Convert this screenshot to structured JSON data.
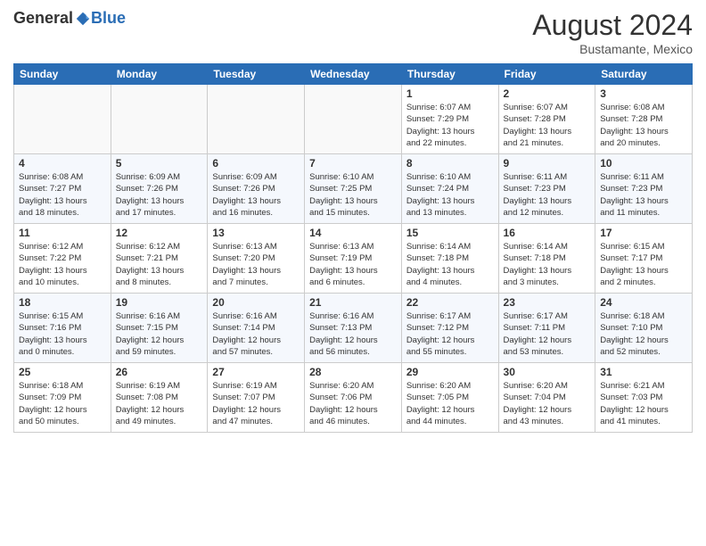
{
  "header": {
    "logo_general": "General",
    "logo_blue": "Blue",
    "month_year": "August 2024",
    "location": "Bustamante, Mexico"
  },
  "weekdays": [
    "Sunday",
    "Monday",
    "Tuesday",
    "Wednesday",
    "Thursday",
    "Friday",
    "Saturday"
  ],
  "weeks": [
    [
      {
        "day": "",
        "info": ""
      },
      {
        "day": "",
        "info": ""
      },
      {
        "day": "",
        "info": ""
      },
      {
        "day": "",
        "info": ""
      },
      {
        "day": "1",
        "info": "Sunrise: 6:07 AM\nSunset: 7:29 PM\nDaylight: 13 hours\nand 22 minutes."
      },
      {
        "day": "2",
        "info": "Sunrise: 6:07 AM\nSunset: 7:28 PM\nDaylight: 13 hours\nand 21 minutes."
      },
      {
        "day": "3",
        "info": "Sunrise: 6:08 AM\nSunset: 7:28 PM\nDaylight: 13 hours\nand 20 minutes."
      }
    ],
    [
      {
        "day": "4",
        "info": "Sunrise: 6:08 AM\nSunset: 7:27 PM\nDaylight: 13 hours\nand 18 minutes."
      },
      {
        "day": "5",
        "info": "Sunrise: 6:09 AM\nSunset: 7:26 PM\nDaylight: 13 hours\nand 17 minutes."
      },
      {
        "day": "6",
        "info": "Sunrise: 6:09 AM\nSunset: 7:26 PM\nDaylight: 13 hours\nand 16 minutes."
      },
      {
        "day": "7",
        "info": "Sunrise: 6:10 AM\nSunset: 7:25 PM\nDaylight: 13 hours\nand 15 minutes."
      },
      {
        "day": "8",
        "info": "Sunrise: 6:10 AM\nSunset: 7:24 PM\nDaylight: 13 hours\nand 13 minutes."
      },
      {
        "day": "9",
        "info": "Sunrise: 6:11 AM\nSunset: 7:23 PM\nDaylight: 13 hours\nand 12 minutes."
      },
      {
        "day": "10",
        "info": "Sunrise: 6:11 AM\nSunset: 7:23 PM\nDaylight: 13 hours\nand 11 minutes."
      }
    ],
    [
      {
        "day": "11",
        "info": "Sunrise: 6:12 AM\nSunset: 7:22 PM\nDaylight: 13 hours\nand 10 minutes."
      },
      {
        "day": "12",
        "info": "Sunrise: 6:12 AM\nSunset: 7:21 PM\nDaylight: 13 hours\nand 8 minutes."
      },
      {
        "day": "13",
        "info": "Sunrise: 6:13 AM\nSunset: 7:20 PM\nDaylight: 13 hours\nand 7 minutes."
      },
      {
        "day": "14",
        "info": "Sunrise: 6:13 AM\nSunset: 7:19 PM\nDaylight: 13 hours\nand 6 minutes."
      },
      {
        "day": "15",
        "info": "Sunrise: 6:14 AM\nSunset: 7:18 PM\nDaylight: 13 hours\nand 4 minutes."
      },
      {
        "day": "16",
        "info": "Sunrise: 6:14 AM\nSunset: 7:18 PM\nDaylight: 13 hours\nand 3 minutes."
      },
      {
        "day": "17",
        "info": "Sunrise: 6:15 AM\nSunset: 7:17 PM\nDaylight: 13 hours\nand 2 minutes."
      }
    ],
    [
      {
        "day": "18",
        "info": "Sunrise: 6:15 AM\nSunset: 7:16 PM\nDaylight: 13 hours\nand 0 minutes."
      },
      {
        "day": "19",
        "info": "Sunrise: 6:16 AM\nSunset: 7:15 PM\nDaylight: 12 hours\nand 59 minutes."
      },
      {
        "day": "20",
        "info": "Sunrise: 6:16 AM\nSunset: 7:14 PM\nDaylight: 12 hours\nand 57 minutes."
      },
      {
        "day": "21",
        "info": "Sunrise: 6:16 AM\nSunset: 7:13 PM\nDaylight: 12 hours\nand 56 minutes."
      },
      {
        "day": "22",
        "info": "Sunrise: 6:17 AM\nSunset: 7:12 PM\nDaylight: 12 hours\nand 55 minutes."
      },
      {
        "day": "23",
        "info": "Sunrise: 6:17 AM\nSunset: 7:11 PM\nDaylight: 12 hours\nand 53 minutes."
      },
      {
        "day": "24",
        "info": "Sunrise: 6:18 AM\nSunset: 7:10 PM\nDaylight: 12 hours\nand 52 minutes."
      }
    ],
    [
      {
        "day": "25",
        "info": "Sunrise: 6:18 AM\nSunset: 7:09 PM\nDaylight: 12 hours\nand 50 minutes."
      },
      {
        "day": "26",
        "info": "Sunrise: 6:19 AM\nSunset: 7:08 PM\nDaylight: 12 hours\nand 49 minutes."
      },
      {
        "day": "27",
        "info": "Sunrise: 6:19 AM\nSunset: 7:07 PM\nDaylight: 12 hours\nand 47 minutes."
      },
      {
        "day": "28",
        "info": "Sunrise: 6:20 AM\nSunset: 7:06 PM\nDaylight: 12 hours\nand 46 minutes."
      },
      {
        "day": "29",
        "info": "Sunrise: 6:20 AM\nSunset: 7:05 PM\nDaylight: 12 hours\nand 44 minutes."
      },
      {
        "day": "30",
        "info": "Sunrise: 6:20 AM\nSunset: 7:04 PM\nDaylight: 12 hours\nand 43 minutes."
      },
      {
        "day": "31",
        "info": "Sunrise: 6:21 AM\nSunset: 7:03 PM\nDaylight: 12 hours\nand 41 minutes."
      }
    ]
  ]
}
